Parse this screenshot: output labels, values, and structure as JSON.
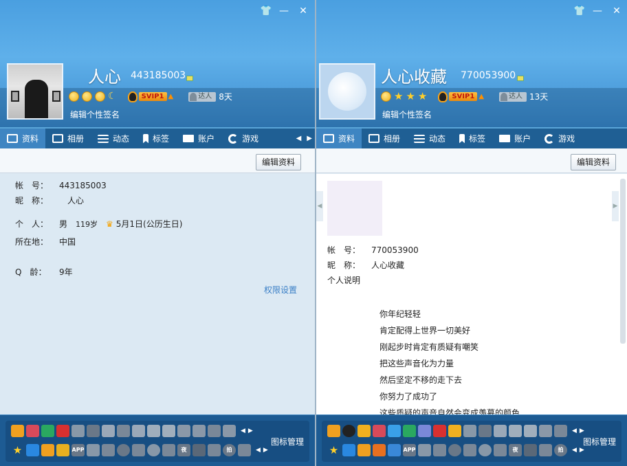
{
  "left": {
    "window_controls": [
      "👕",
      "—",
      "✕"
    ],
    "name": "人心",
    "qq": "443185003",
    "vip_label": "SVIP1",
    "daren_label": "达人",
    "daren_days": "8天",
    "signature": "编辑个性签名",
    "tabs": [
      "资料",
      "相册",
      "动态",
      "标签",
      "账户",
      "游戏"
    ],
    "edit_button": "编辑资料",
    "profile": [
      {
        "key": "帐　号：",
        "value": "443185003"
      },
      {
        "key": "昵　称：",
        "value": "　人心"
      },
      {
        "key": "个　人：",
        "value": "男",
        "age": "119岁",
        "birthday": "5月1日(公历生日)"
      },
      {
        "key": "所在地：",
        "value": "中国"
      },
      {
        "key": "Q　龄：",
        "value": "9年"
      }
    ],
    "permission_link": "权限设置",
    "icon_manager": "图标管理"
  },
  "right": {
    "window_controls": [
      "👕",
      "—",
      "✕"
    ],
    "name": "人心收藏",
    "qq": "770053900",
    "vip_label": "SVIP1",
    "daren_label": "达人",
    "daren_days": "13天",
    "signature": "编辑个性签名",
    "tabs": [
      "资料",
      "相册",
      "动态",
      "标签",
      "账户",
      "游戏"
    ],
    "edit_button": "编辑资料",
    "profile": [
      {
        "key": "帐　号：",
        "value": "770053900"
      },
      {
        "key": "昵　称：",
        "value": "人心收藏"
      }
    ],
    "personal_desc_label": "个人说明",
    "poem": [
      "你年纪轻轻",
      "肯定配得上世界一切美好",
      "刚起步时肯定有质疑有嘲笑",
      "把这些声音化为力量",
      "然后坚定不移的走下去",
      "你努力了成功了",
      "这些质疑的声音自然会变成羡慕的颜色"
    ],
    "icon_manager": "图标管理"
  },
  "footer_icons_text": {
    "app": "APP",
    "night": "夜",
    "pai": "拍"
  },
  "colors": {
    "header_blue": "#4a9fe0",
    "tab_bar": "#1f5f94",
    "footer": "#1d5b93",
    "link": "#3a7fc6"
  }
}
